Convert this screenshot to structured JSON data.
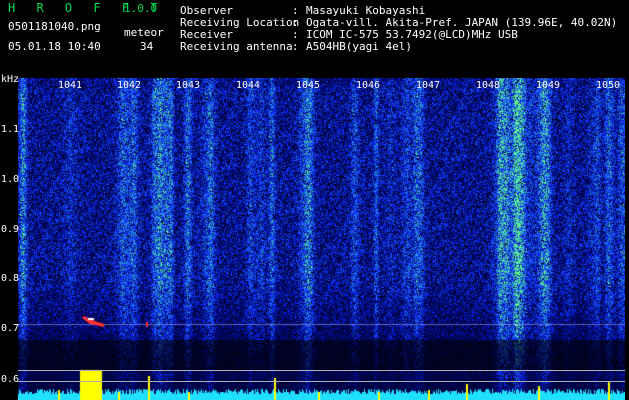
{
  "header": {
    "app_title": "H R O F F T",
    "version": "1.0.0",
    "file_name": "0501181040.png",
    "meteor_label": "meteor",
    "datetime": "05.01.18 10:40",
    "meteor_count": "34"
  },
  "info": {
    "observer_label": "Observer",
    "observer_value": "Masayuki Kobayashi",
    "location_label": "Receiving Location",
    "location_value": "Ogata-vill. Akita-Pref. JAPAN (139.96E, 40.02N)",
    "receiver_label": "Receiver",
    "receiver_value": "ICOM IC-575 53.7492(@LCD)MHz USB",
    "antenna_label": "Receiving antenna",
    "antenna_value": "A504HB(yagi 4el)",
    "colon": ":"
  },
  "axes": {
    "y_unit": "kHz",
    "x_ticks": [
      "1041",
      "1042",
      "1043",
      "1044",
      "1045",
      "1046",
      "1047",
      "1048",
      "1049",
      "1050"
    ],
    "y_ticks": [
      "1.1",
      "1.0",
      "0.9",
      "0.8",
      "0.7",
      "0.6"
    ]
  },
  "colors": {
    "background": "#000000",
    "title_green": "#00d850",
    "text_white": "#ffffff",
    "spectrum_low": "#000a40",
    "spectrum_mid": "#2050ff",
    "spectrum_high": "#30e0a0",
    "meteor_red": "#ff3030",
    "meteor_yellow": "#ffff00",
    "baseline_cyan": "#20e0ff"
  }
}
